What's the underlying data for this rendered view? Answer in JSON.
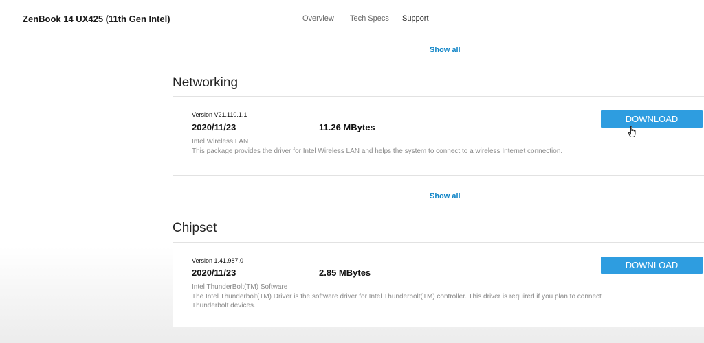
{
  "header": {
    "product_name": "ZenBook 14 UX425 (11th Gen Intel)",
    "nav": {
      "overview": "Overview",
      "tech_specs": "Tech Specs",
      "support": "Support"
    }
  },
  "show_all_label": "Show all",
  "sections": [
    {
      "title": "Networking",
      "driver": {
        "version": "Version V21.110.1.1",
        "date": "2020/11/23",
        "size": "11.26 MBytes",
        "name": "Intel Wireless LAN",
        "description": "This package provides the driver for Intel Wireless LAN and helps the system to connect to a wireless Internet connection.",
        "button_label": "DOWNLOAD"
      }
    },
    {
      "title": "Chipset",
      "driver": {
        "version": "Version 1.41.987.0",
        "date": "2020/11/23",
        "size": "2.85 MBytes",
        "name": "Intel ThunderBolt(TM) Software",
        "description": "The Intel Thunderbolt(TM) Driver is the software driver for Intel Thunderbolt(TM) controller. This driver is required if you plan to connect Thunderbolt devices.",
        "button_label": "DOWNLOAD"
      }
    }
  ],
  "colors": {
    "accent": "#2e9de0",
    "link": "#1185c7"
  },
  "icons": {
    "cursor": "hand-pointer-icon"
  }
}
